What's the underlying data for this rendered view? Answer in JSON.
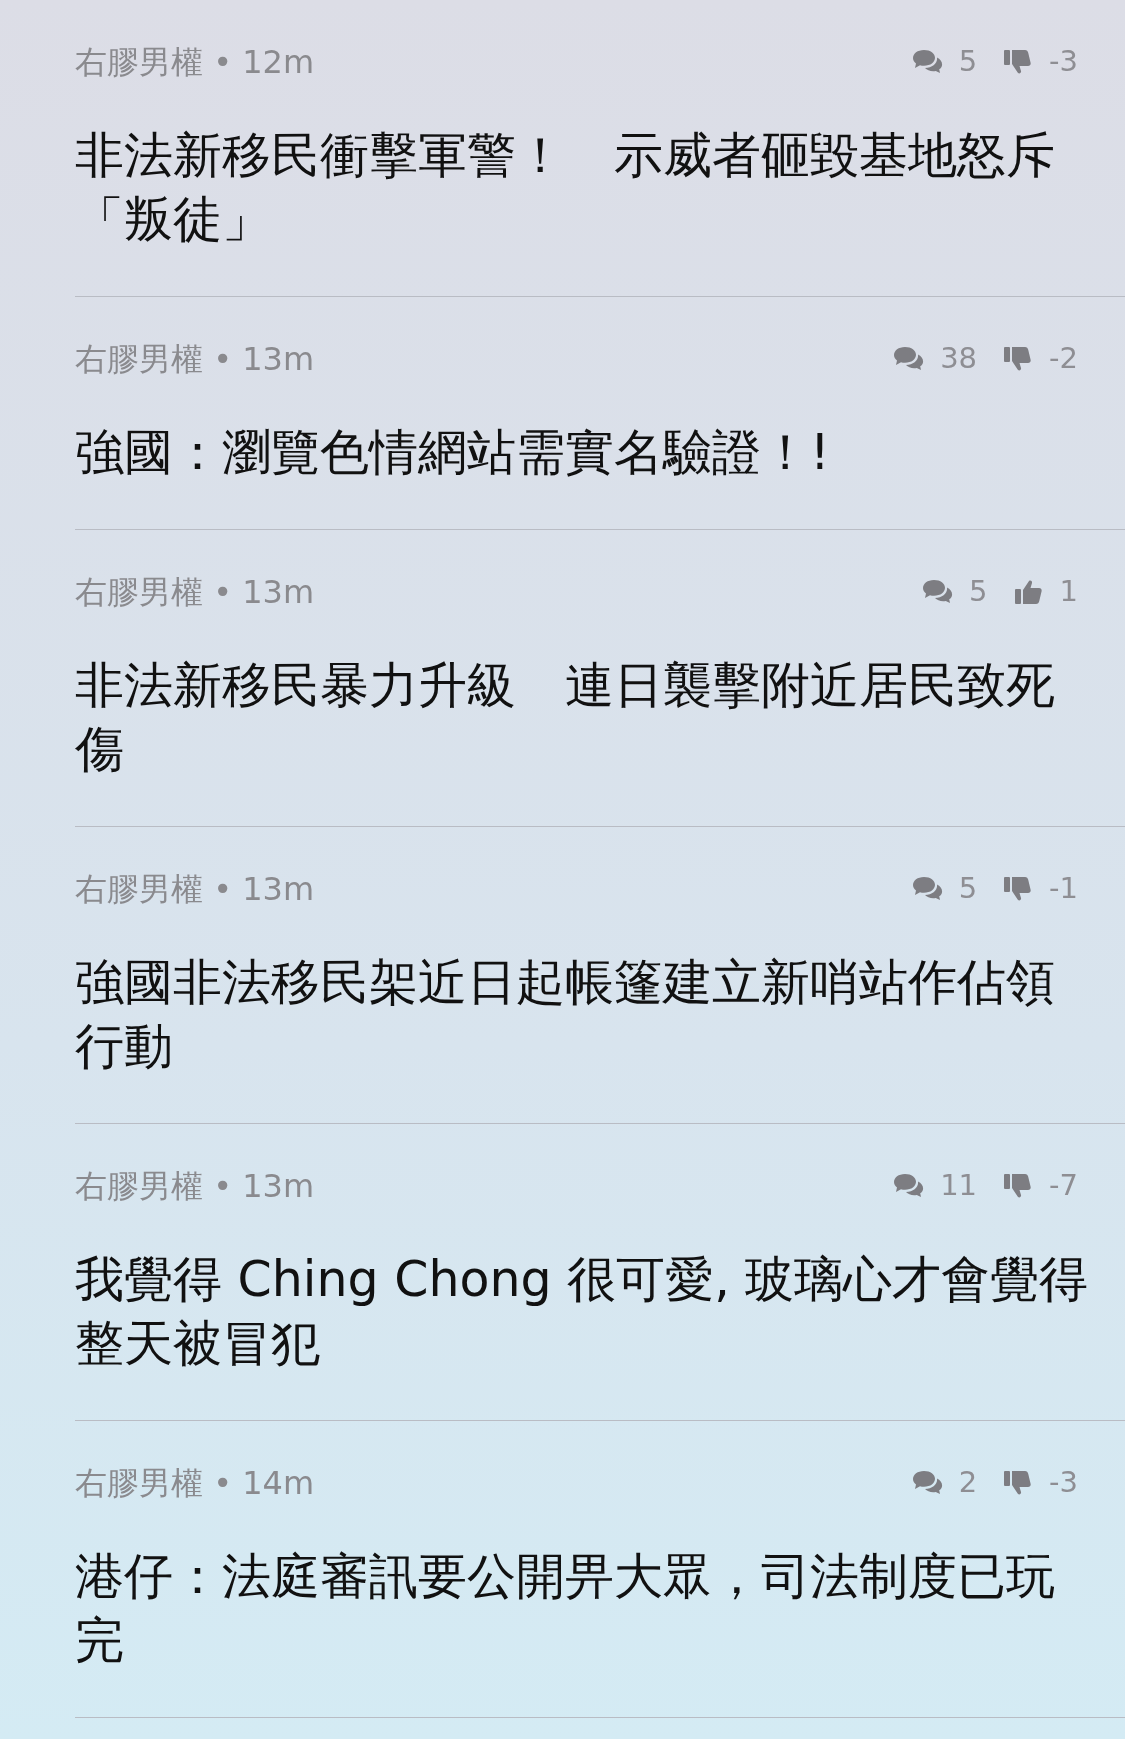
{
  "posts": [
    {
      "meta": "右膠男權 • 12m",
      "comments": "5",
      "vote": {
        "kind": "down",
        "count": "-3"
      },
      "title": "非法新移民衝擊軍警！　示威者砸毀基地怒斥「叛徒」"
    },
    {
      "meta": "右膠男權 • 13m",
      "comments": "38",
      "vote": {
        "kind": "down",
        "count": "-2"
      },
      "title": "強國：瀏覽色情網站需實名驗證！!"
    },
    {
      "meta": "右膠男權 • 13m",
      "comments": "5",
      "vote": {
        "kind": "up",
        "count": "1"
      },
      "title": "非法新移民暴力升級　連日襲擊附近居民致死傷"
    },
    {
      "meta": "右膠男權 • 13m",
      "comments": "5",
      "vote": {
        "kind": "down",
        "count": "-1"
      },
      "title": "強國非法移民架近日起帳篷建立新哨站作佔領行動"
    },
    {
      "meta": "右膠男權 • 13m",
      "comments": "11",
      "vote": {
        "kind": "down",
        "count": "-7"
      },
      "title": "我覺得 Ching Chong 很可愛, 玻璃心才會覺得整天被冒犯"
    },
    {
      "meta": "右膠男權 • 14m",
      "comments": "2",
      "vote": {
        "kind": "down",
        "count": "-3"
      },
      "title": "港仔：法庭審訊要公開畀大眾，司法制度已玩完"
    }
  ]
}
